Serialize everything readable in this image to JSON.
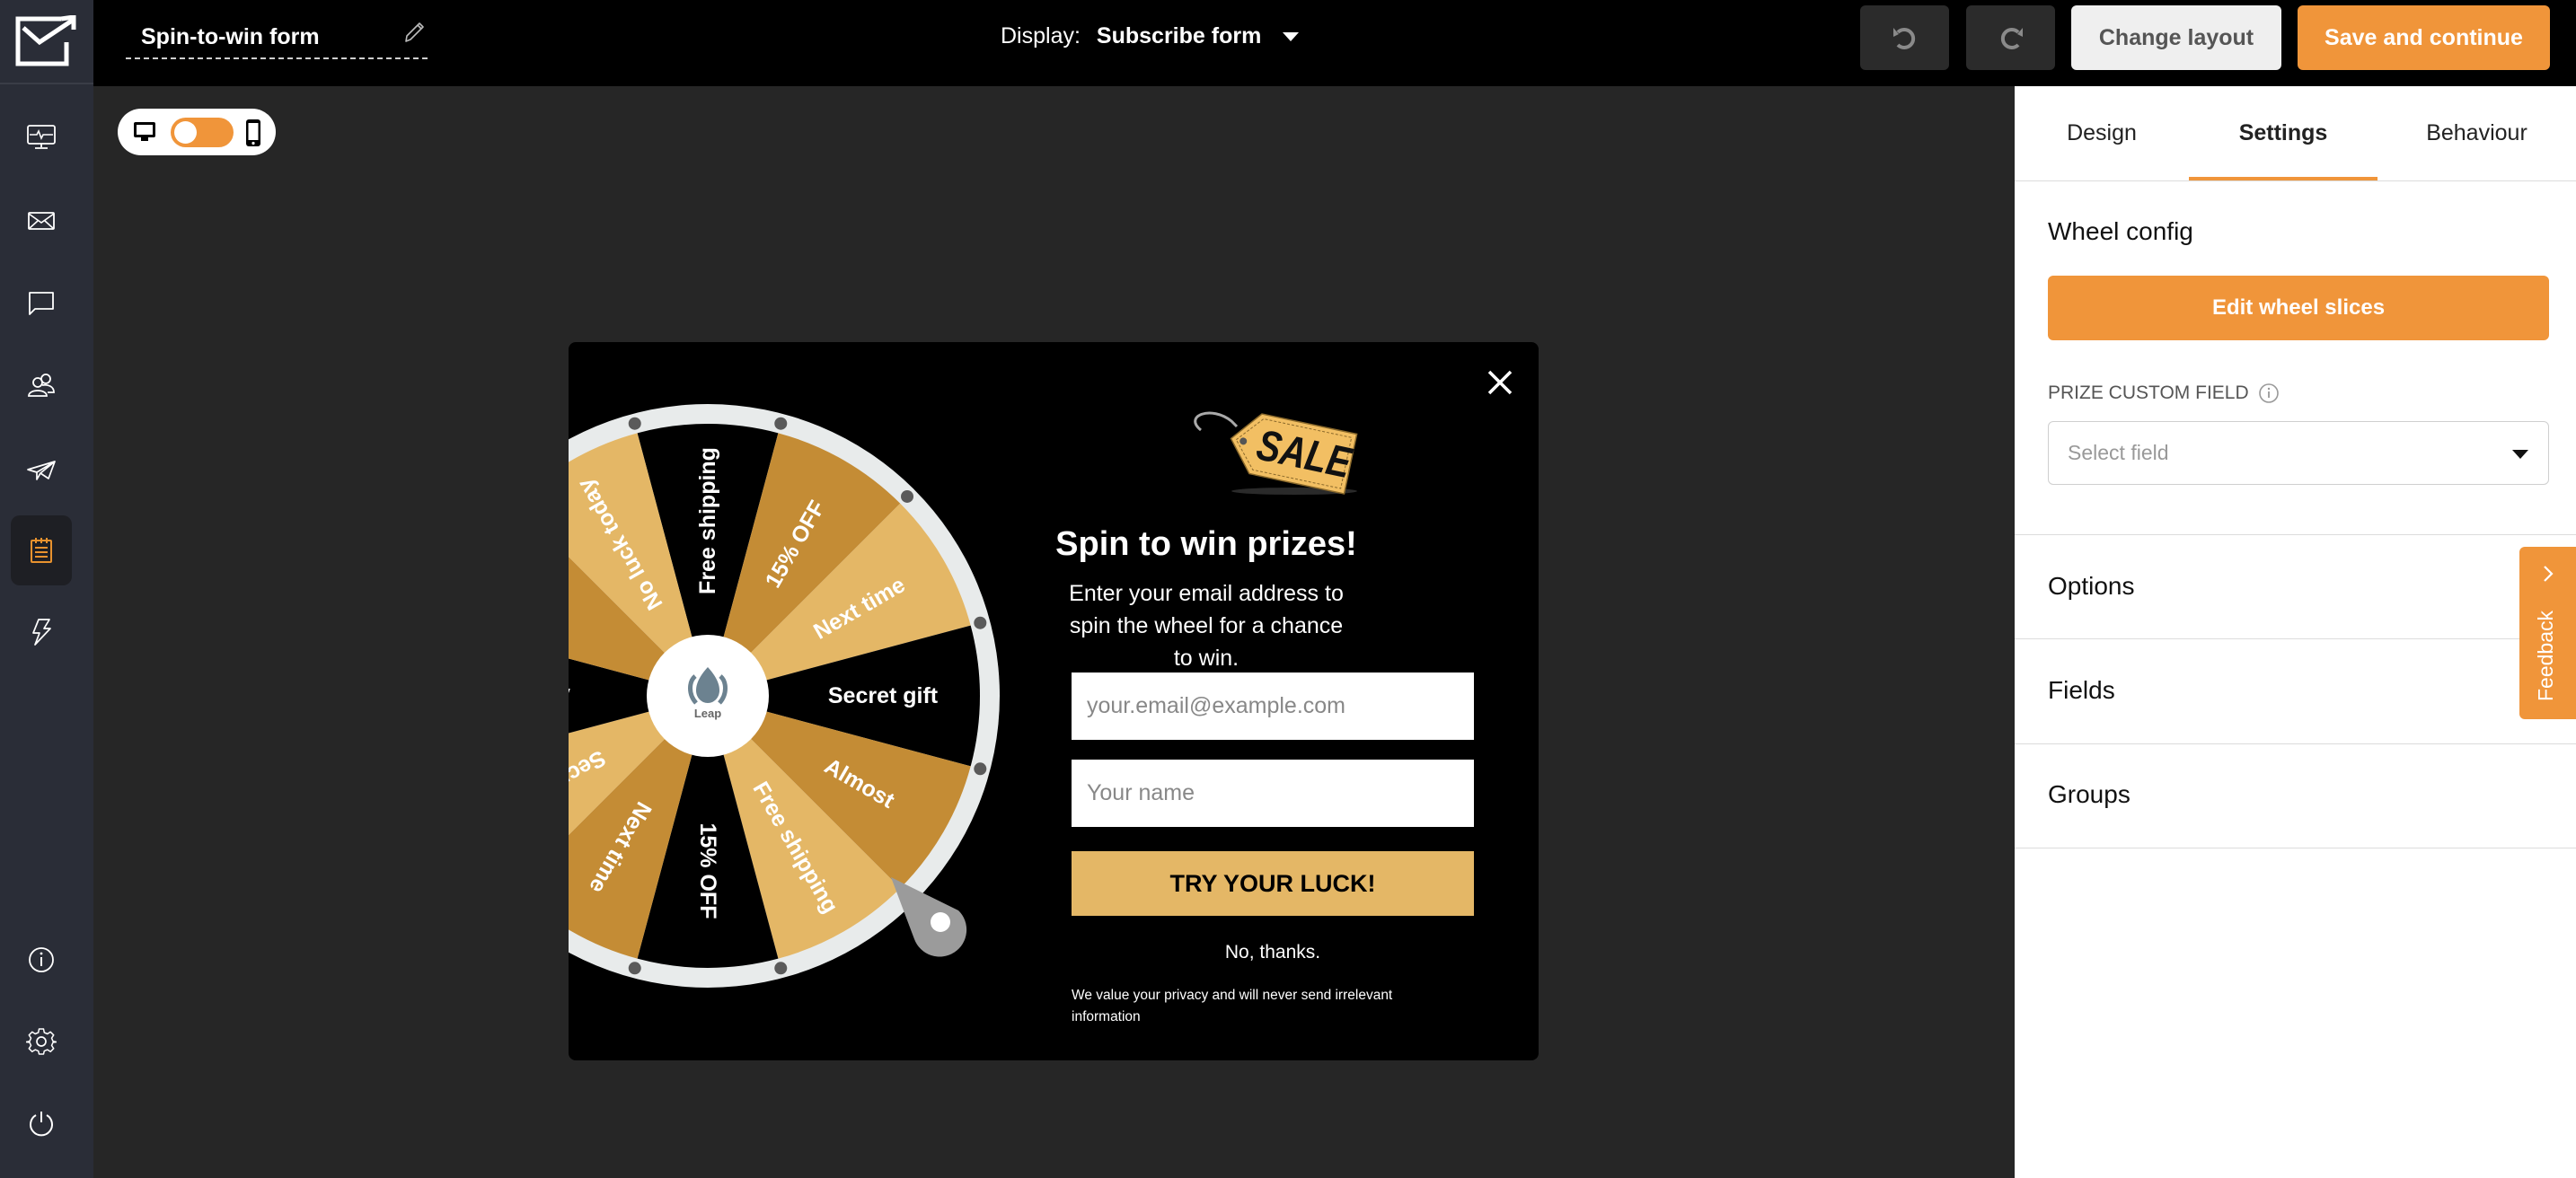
{
  "app": {
    "form_title": "Spin-to-win form",
    "display_label": "Display:",
    "display_value": "Subscribe form"
  },
  "toolbar": {
    "undo_icon": "undo-icon",
    "redo_icon": "redo-icon",
    "change_layout_label": "Change layout",
    "save_label": "Save and continue"
  },
  "sidebar": {
    "items": [
      {
        "icon": "dashboard-monitor-icon",
        "active": false
      },
      {
        "icon": "envelope-icon",
        "active": false
      },
      {
        "icon": "chat-icon",
        "active": false
      },
      {
        "icon": "subscribers-icon",
        "active": false
      },
      {
        "icon": "paper-plane-icon",
        "active": false
      },
      {
        "icon": "forms-notepad-icon",
        "active": true
      },
      {
        "icon": "automation-bolt-icon",
        "active": false
      }
    ],
    "bottom_items": [
      {
        "icon": "info-icon"
      },
      {
        "icon": "gear-icon"
      },
      {
        "icon": "power-icon"
      }
    ]
  },
  "device_toggle": {
    "left_icon": "desktop-icon",
    "right_icon": "mobile-icon",
    "selected": "desktop"
  },
  "popup": {
    "sale_tag_text": "SALE",
    "headline": "Spin to win prizes!",
    "subtext": "Enter your email address to spin the wheel for a chance to win.",
    "email_placeholder": "your.email@example.com",
    "name_placeholder": "Your name",
    "cta_label": "TRY YOUR LUCK!",
    "decline_label": "No, thanks.",
    "privacy_text": "We value your privacy and will never send irrelevant information",
    "wheel": {
      "hub_label": "Leap",
      "colors": {
        "black": "#000000",
        "dark_gold": "#c48c35",
        "light_gold": "#e4b766",
        "ring": "#e8ebeb",
        "peg": "#5a5a5a",
        "pointer": "#9b9b9b"
      },
      "slices": [
        {
          "label": "Free shipping",
          "color": "black"
        },
        {
          "label": "15% OFF",
          "color": "dark_gold"
        },
        {
          "label": "Next time",
          "color": "light_gold"
        },
        {
          "label": "Secret gift",
          "color": "black"
        },
        {
          "label": "Almost",
          "color": "dark_gold"
        },
        {
          "label": "Free shipping",
          "color": "light_gold"
        },
        {
          "label": "15% OFF",
          "color": "black"
        },
        {
          "label": "Next time",
          "color": "dark_gold"
        },
        {
          "label": "Secret gift",
          "color": "light_gold"
        },
        {
          "label": "Almost",
          "color": "black"
        },
        {
          "label": "",
          "color": "dark_gold"
        },
        {
          "label": "No luck today",
          "color": "light_gold"
        }
      ]
    }
  },
  "panel": {
    "tabs": [
      {
        "label": "Design",
        "active": false
      },
      {
        "label": "Settings",
        "active": true
      },
      {
        "label": "Behaviour",
        "active": false
      }
    ],
    "wheel_config_title": "Wheel config",
    "edit_slices_label": "Edit wheel slices",
    "prize_field_label": "PRIZE CUSTOM FIELD",
    "prize_field_placeholder": "Select field",
    "sections": [
      "Options",
      "Fields",
      "Groups"
    ],
    "feedback_label": "Feedback"
  },
  "colors": {
    "accent": "#f0953a",
    "sidebar": "#2a2d37",
    "canvas": "#262626"
  }
}
